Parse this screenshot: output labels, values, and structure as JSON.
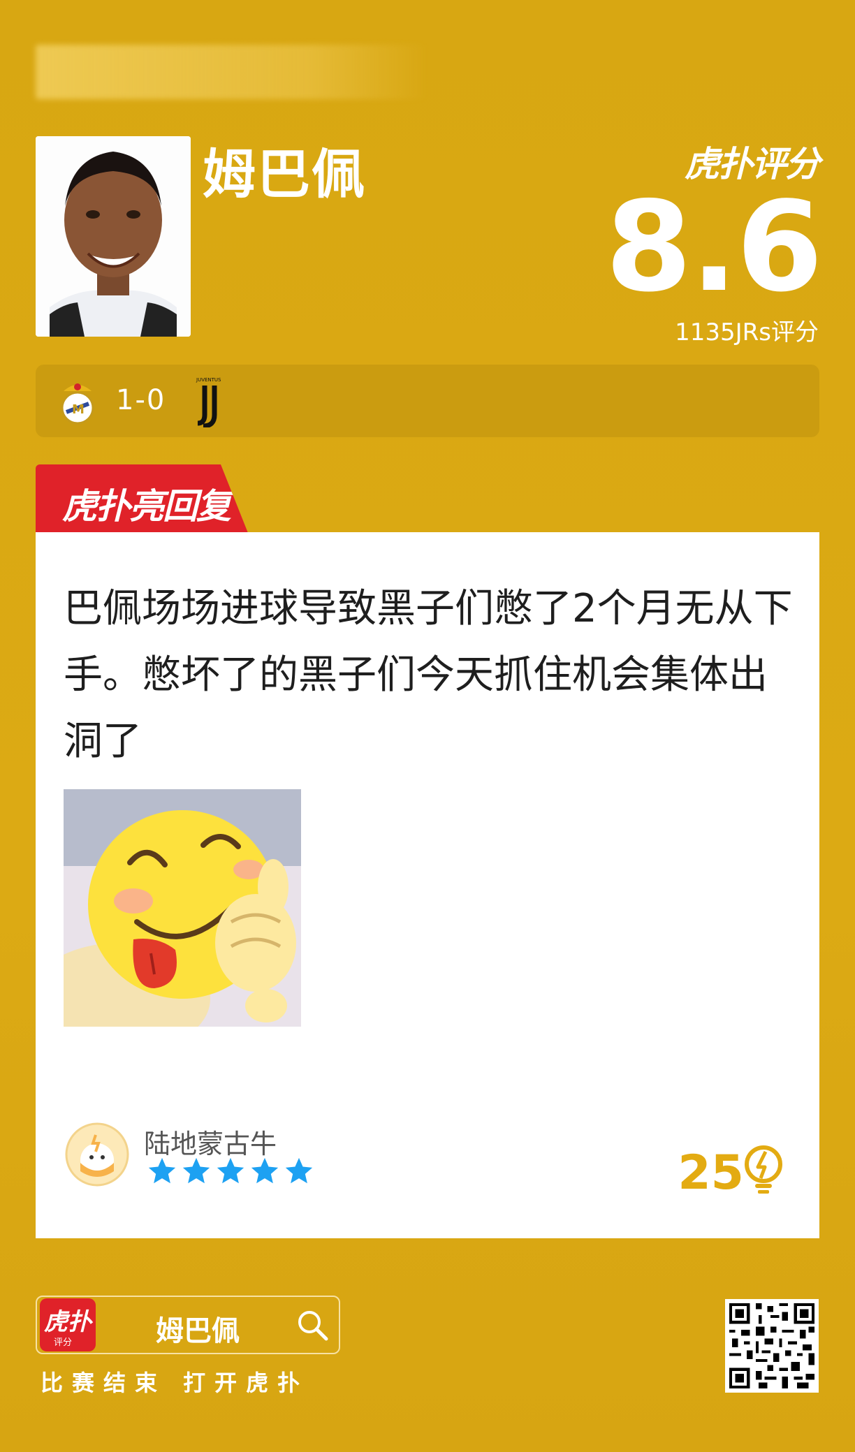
{
  "header": {
    "player_name": "姆巴佩",
    "brand_rating": "虎扑评分",
    "score": "8.6",
    "rating_count": "1135JRs评分"
  },
  "match": {
    "home_team_icon": "real-madrid-crest-icon",
    "score": "1-0",
    "away_team_icon": "juventus-logo-icon"
  },
  "hot_reply": {
    "tab_label": "虎扑亮回复"
  },
  "comment": {
    "text": "巴佩场场进球导致黑子们憋了2个月无从下手。憋坏了的黑子们今天抓住机会集体出洞了",
    "image_icon": "tongue-out-thumbs-up-emoji",
    "user_name": "陆地蒙古牛",
    "stars": 5,
    "likes": "25",
    "star_color": "#1da1f2",
    "like_color": "#e3ab12"
  },
  "footer": {
    "app_icon_text": "虎扑",
    "app_icon_sub": "评分",
    "search_text": "姆巴佩",
    "caption": "比赛结束 打开虎扑"
  },
  "colors": {
    "background": "#d9a811",
    "accent_red": "#e02229"
  }
}
